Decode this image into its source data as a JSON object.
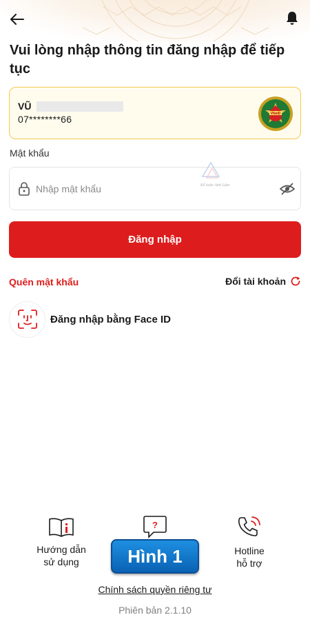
{
  "header": {
    "back_icon": "arrow-left-icon",
    "notification_icon": "bell-icon"
  },
  "title": "Vui lòng nhập thông tin đăng nhập để tiếp tục",
  "account": {
    "name": "VŨ",
    "phone": "07********66",
    "logo": "organization-emblem",
    "logo_text": "VNeID",
    "border_color": "#f2c94c"
  },
  "password": {
    "label": "Mật khẩu",
    "placeholder": "Nhập mật khẩu",
    "value": "",
    "lock_icon": "lock-icon",
    "toggle_icon": "eye-off-icon"
  },
  "watermark_text": "Kế toán Anh Lâm",
  "login_button": "Đăng nhập",
  "forgot_password": "Quên mật khẩu",
  "switch_account": "Đổi tài khoản",
  "face_id": "Đăng nhập bằng Face ID",
  "bottom": {
    "guide": "Hướng dẫn\nsử dụng",
    "hotline": "Hotline\nhỗ trợ",
    "faq_icon": "question-bubble-icon"
  },
  "badge": "Hình 1",
  "privacy": "Chính sách quyền riêng tư",
  "version": "Phiên bản 2.1.10",
  "colors": {
    "primary": "#dd1d1d",
    "badge": "#0a62b3",
    "muted": "#808080"
  }
}
